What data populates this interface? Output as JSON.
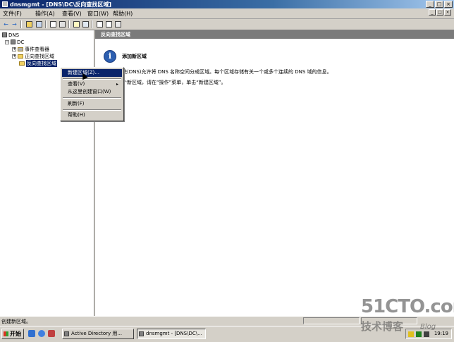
{
  "window": {
    "title": "dnsmgmt - [DNS\\DC\\反向查找区域]",
    "buttons": [
      "_",
      "□",
      "×"
    ],
    "mdi_buttons": [
      "_",
      "□",
      "×"
    ]
  },
  "menu": {
    "items": [
      "文件(F)",
      "操作(A)",
      "查看(V)",
      "窗口(W)",
      "帮助(H)"
    ]
  },
  "toolbar": {
    "back": "←",
    "forward": "→"
  },
  "tree": {
    "root": "DNS",
    "server": "DC",
    "children": [
      "事件查看器",
      "正向查找区域",
      "反向查找区域"
    ],
    "expander_minus": "−",
    "expander_plus": "+"
  },
  "right_pane": {
    "header": "反向查找区域",
    "info_icon_glyph": "i",
    "info_title": "添加新区域",
    "line1": "统(DNS)允许将 DNS 名称空间分成区域。每个区域存储有关一个或多个连续的 DNS 域的信息。",
    "line2": "个新区域，请在“操作”菜单，单击“新建区域”。"
  },
  "context_menu": {
    "items": [
      "新建区域(Z)...",
      "查看(V)",
      "从这里创建窗口(W)",
      "刷新(F)",
      "帮助(H)"
    ],
    "submenu_arrow": "▸"
  },
  "status_bar": {
    "text": "创建新区域。"
  },
  "taskbar": {
    "start_label": "开始",
    "tasks": [
      "Active Directory 用...",
      "dnsmgmt - [DNS\\DC\\..."
    ],
    "clock": "19:19"
  },
  "watermark": {
    "site": "51CTO.com",
    "label": "技术博客",
    "blog": "Blog"
  },
  "colors": {
    "titlebar": "#0a246a",
    "selection": "#0a246a",
    "pane_header": "#7b7b7b",
    "info_icon": "#2d5fb0"
  }
}
